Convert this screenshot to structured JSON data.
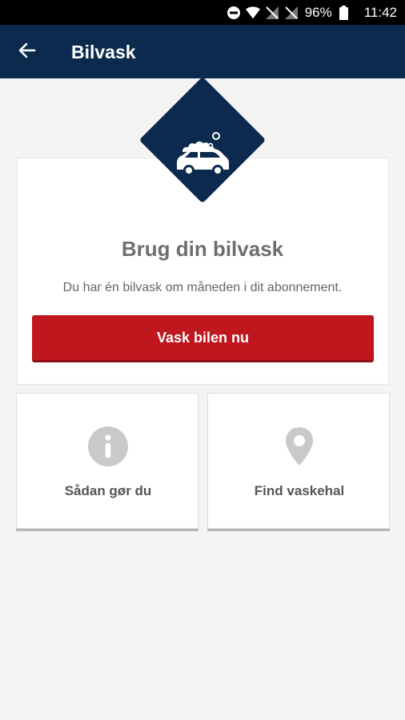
{
  "status_bar": {
    "battery_percent": "96%",
    "time": "11:42"
  },
  "app_bar": {
    "title": "Bilvask"
  },
  "main_card": {
    "title": "Brug din bilvask",
    "subtitle": "Du har én bilvask om måneden i dit abonnement.",
    "button_label": "Vask bilen nu"
  },
  "tiles": [
    {
      "label": "Sådan gør du",
      "icon": "info-icon"
    },
    {
      "label": "Find vaskehal",
      "icon": "location-pin-icon"
    }
  ],
  "colors": {
    "app_bar": "#0b2a4d",
    "primary_button": "#c0161e",
    "icon_gray": "#c9c9c9"
  }
}
